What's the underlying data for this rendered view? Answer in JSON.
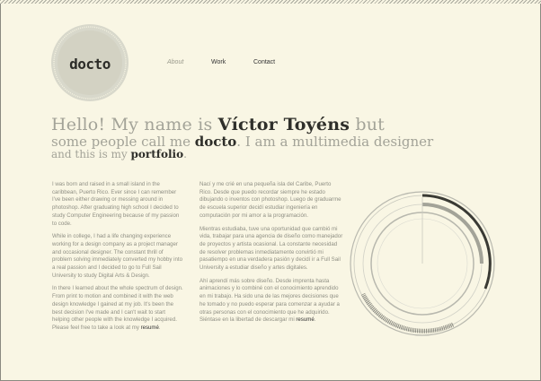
{
  "logo": {
    "text": "docto"
  },
  "nav": {
    "items": [
      "About",
      "Work",
      "Contact"
    ],
    "active": "About"
  },
  "headline": {
    "line1_pre": "Hello! My name is ",
    "line1_name": "Víctor Toyéns",
    "line1_post": " but",
    "line2_pre": "some people call me ",
    "line2_nick": "docto",
    "line2_post": ". I am a multimedia designer",
    "line3_pre": "and this is my ",
    "line3_link": "portfolio",
    "line3_post": "."
  },
  "about_en": {
    "p1": "I was born and raised in a small island in the caribbean, Puerto Rico. Ever since I can remember I've been either drawing or messing around in photoshop. After graduating high school I decided to study Computer Engineering because of my passion to code.",
    "p2": "While in college, I had a life changing experience working for a design company as a project manager and occasional designer. The constant thrill of problem solving immediately converted my hobby into a real passion and I decided to go to Full Sail University to study Digital Arts & Design.",
    "p3_text": "In there I learned about the whole spectrum of design. From print to motion and combined it with the web design knowledge I gained at my job. It's been the best decision I've made and I can't wait to start helping other people with the knowledge I acquired. Please feel free to take a look at my ",
    "p3_link": "resumé",
    "p3_end": "."
  },
  "about_es": {
    "p1": "Nací y me crié en una pequeña isla del Caribe, Puerto Rico. Desde que puedo recordar siempre he estado dibujando o inventos con photoshop. Luego de graduarme de escuela superior decidí estudiar ingeniería en computación por mi amor a la programación.",
    "p2": "Mientras estudiaba, tuve una oportunidad que cambió mi vida, trabajar para una agencia de diseño como manejador de proyectos y artista ocasional. La constante necesidad de resolver problemas inmediatamente convirtió mi pasatiempo en una verdadera pasión y decidí ir a Full Sail University a estudiar diseño y artes digitales.",
    "p3_text": "Ahí aprendí más sobre diseño. Desde imprenta hasta animaciones y lo combiné con el conocimiento aprendido en mi trabajo. Ha sido una de las mejores decisiones que he tomado y no puedo esperar para comenzar a ayudar a otras personas con el conocimiento que he adquirido. Siéntase en la libertad de descargar mi ",
    "p3_link": "resumé",
    "p3_end": "."
  },
  "colors": {
    "background": "#f9f6e4",
    "muted": "#a3a398",
    "dark": "#2f2f2a",
    "ring": "#b8b8ae"
  }
}
